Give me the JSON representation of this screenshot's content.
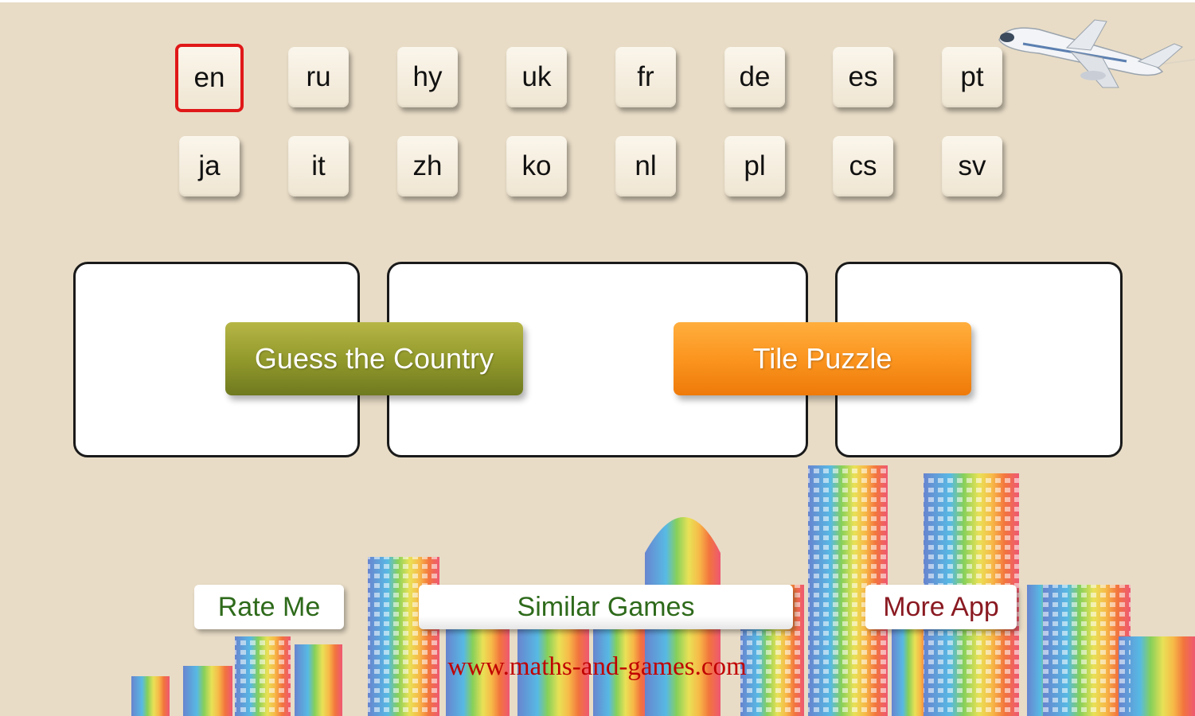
{
  "languages": {
    "selected": "en",
    "row1": [
      "en",
      "ru",
      "hy",
      "uk",
      "fr",
      "de",
      "es",
      "pt"
    ],
    "row2": [
      "ja",
      "it",
      "zh",
      "ko",
      "nl",
      "pl",
      "cs",
      "sv"
    ]
  },
  "games": {
    "guess_label": "Guess the Country",
    "tile_label": "Tile Puzzle"
  },
  "footer": {
    "rate_label": "Rate Me",
    "similar_label": "Similar Games",
    "more_label": "More App",
    "url": "www.maths-and-games.com"
  },
  "colors": {
    "background": "#e8dcc6",
    "selected_border": "#e01818",
    "guess_button": "#939a2c",
    "tile_button": "#fb951f",
    "url_text": "#c00000"
  },
  "icons": [
    "airplane-icon",
    "city-skyline-illustration"
  ]
}
